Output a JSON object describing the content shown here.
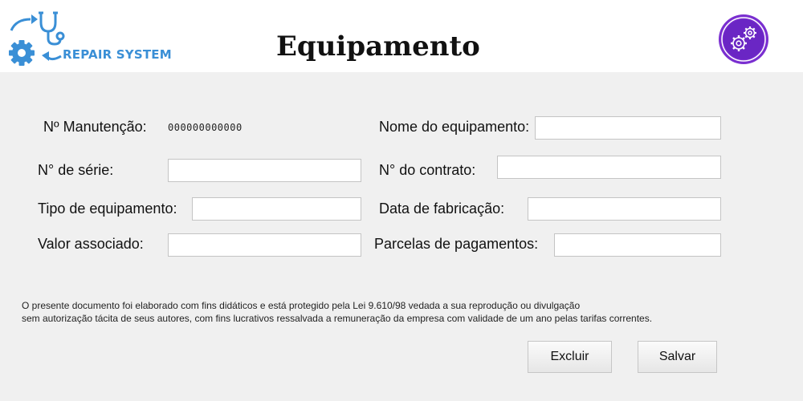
{
  "header": {
    "logo_text": "REPAIR SYSTEM",
    "title": "Equipamento",
    "settings_icon": "gears-icon",
    "accent_color": "#7a2fd0"
  },
  "form": {
    "maintenance_number_label": "Nº Manutenção:",
    "maintenance_number_value": "000000000000",
    "serial_label": "N° de série:",
    "serial_value": "",
    "equipment_type_label": "Tipo de equipamento:",
    "equipment_type_value": "",
    "associated_value_label": "Valor associado:",
    "associated_value_value": "",
    "equipment_name_label": "Nome do equipamento:",
    "equipment_name_value": "",
    "contract_label": "N° do contrato:",
    "contract_value": "",
    "manufacture_date_label": "Data de fabricação:",
    "manufacture_date_value": "",
    "installments_label": "Parcelas de pagamentos:",
    "installments_value": ""
  },
  "notice": {
    "line1": "O presente documento foi elaborado com fins didáticos e está protegido pela Lei 9.610/98 vedada a sua reprodução ou divulgação",
    "line2": " sem autorização tácita de seus autores, com fins lucrativos ressalvada a remuneração da empresa com validade de um ano pelas tarifas correntes."
  },
  "actions": {
    "delete_label": "Excluir",
    "save_label": "Salvar"
  }
}
